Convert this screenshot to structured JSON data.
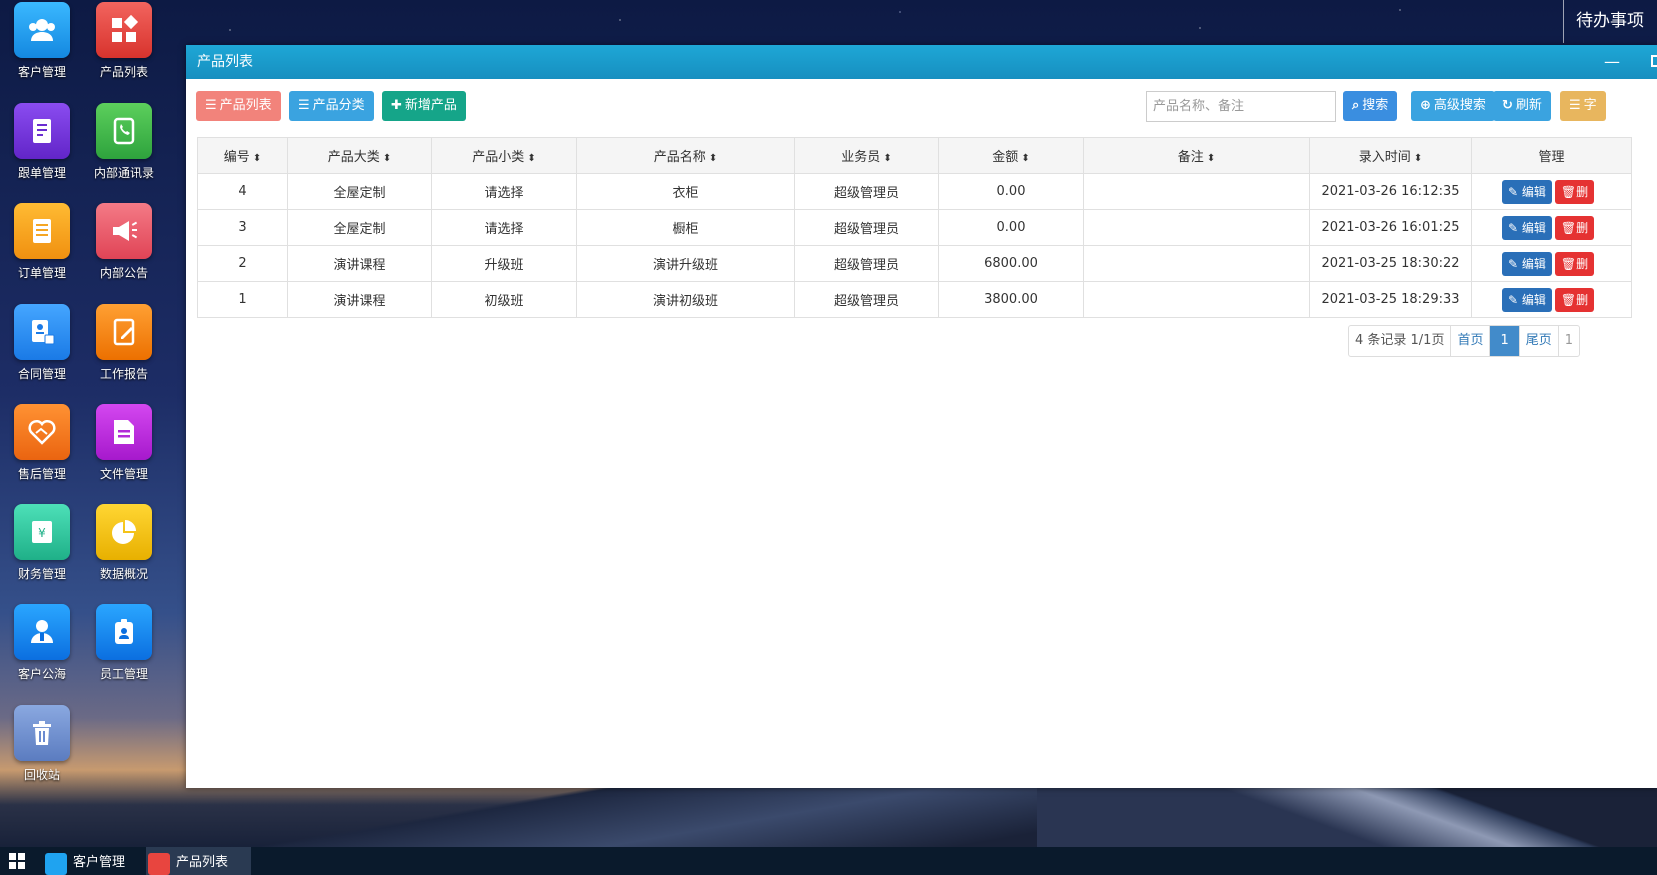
{
  "desktop_icons": [
    {
      "label": "客户管理",
      "icon": "users-icon",
      "color": "#1fa3f0"
    },
    {
      "label": "产品列表",
      "icon": "grid-diamond-icon",
      "color": "#e8453f"
    },
    {
      "label": "跟单管理",
      "icon": "notebook-icon",
      "color": "#7a3be0"
    },
    {
      "label": "内部通讯录",
      "icon": "phone-book-icon",
      "color": "#3ab54a"
    },
    {
      "label": "订单管理",
      "icon": "document-list-icon",
      "color": "#f5a623"
    },
    {
      "label": "内部公告",
      "icon": "megaphone-icon",
      "color": "#ee5a6b"
    },
    {
      "label": "合同管理",
      "icon": "contract-icon",
      "color": "#2a8ff0"
    },
    {
      "label": "工作报告",
      "icon": "report-pen-icon",
      "color": "#f58a12"
    },
    {
      "label": "售后管理",
      "icon": "handshake-heart-icon",
      "color": "#f57a1d"
    },
    {
      "label": "文件管理",
      "icon": "file-icon",
      "color": "#c42ee0"
    },
    {
      "label": "财务管理",
      "icon": "finance-icon",
      "color": "#2cc9a0"
    },
    {
      "label": "数据概况",
      "icon": "pie-chart-icon",
      "color": "#f5c314"
    },
    {
      "label": "客户公海",
      "icon": "customer-pool-icon",
      "color": "#1b8af5"
    },
    {
      "label": "员工管理",
      "icon": "badge-icon",
      "color": "#1b8af5"
    },
    {
      "label": "回收站",
      "icon": "trash-icon",
      "color": "#6d8fd0"
    }
  ],
  "todo_label": "待办事项",
  "window": {
    "title": "产品列表",
    "minimize_label": "—"
  },
  "toolbar": {
    "product_list": "产品列表",
    "product_category": "产品分类",
    "add_product": "新增产品",
    "search_placeholder": "产品名称、备注",
    "search": "搜索",
    "advanced_search": "高级搜索",
    "refresh": "刷新",
    "fields": "字"
  },
  "table": {
    "headers": [
      "编号",
      "产品大类",
      "产品小类",
      "产品名称",
      "业务员",
      "金额",
      "备注",
      "录入时间",
      "管理"
    ],
    "rows": [
      [
        "4",
        "全屋定制",
        "请选择",
        "衣柜",
        "超级管理员",
        "0.00",
        "",
        "2021-03-26 16:12:35"
      ],
      [
        "3",
        "全屋定制",
        "请选择",
        "橱柜",
        "超级管理员",
        "0.00",
        "",
        "2021-03-26 16:01:25"
      ],
      [
        "2",
        "演讲课程",
        "升级班",
        "演讲升级班",
        "超级管理员",
        "6800.00",
        "",
        "2021-03-25 18:30:22"
      ],
      [
        "1",
        "演讲课程",
        "初级班",
        "演讲初级班",
        "超级管理员",
        "3800.00",
        "",
        "2021-03-25 18:29:33"
      ]
    ],
    "edit_label": "编辑",
    "delete_label": "删"
  },
  "pager": {
    "info": "4 条记录 1/1页",
    "first": "首页",
    "current": "1",
    "last": "尾页",
    "jump": "1"
  },
  "taskbar": {
    "items": [
      {
        "label": "客户管理",
        "color": "#1fa3f0"
      },
      {
        "label": "产品列表",
        "color": "#e8453f"
      }
    ]
  }
}
